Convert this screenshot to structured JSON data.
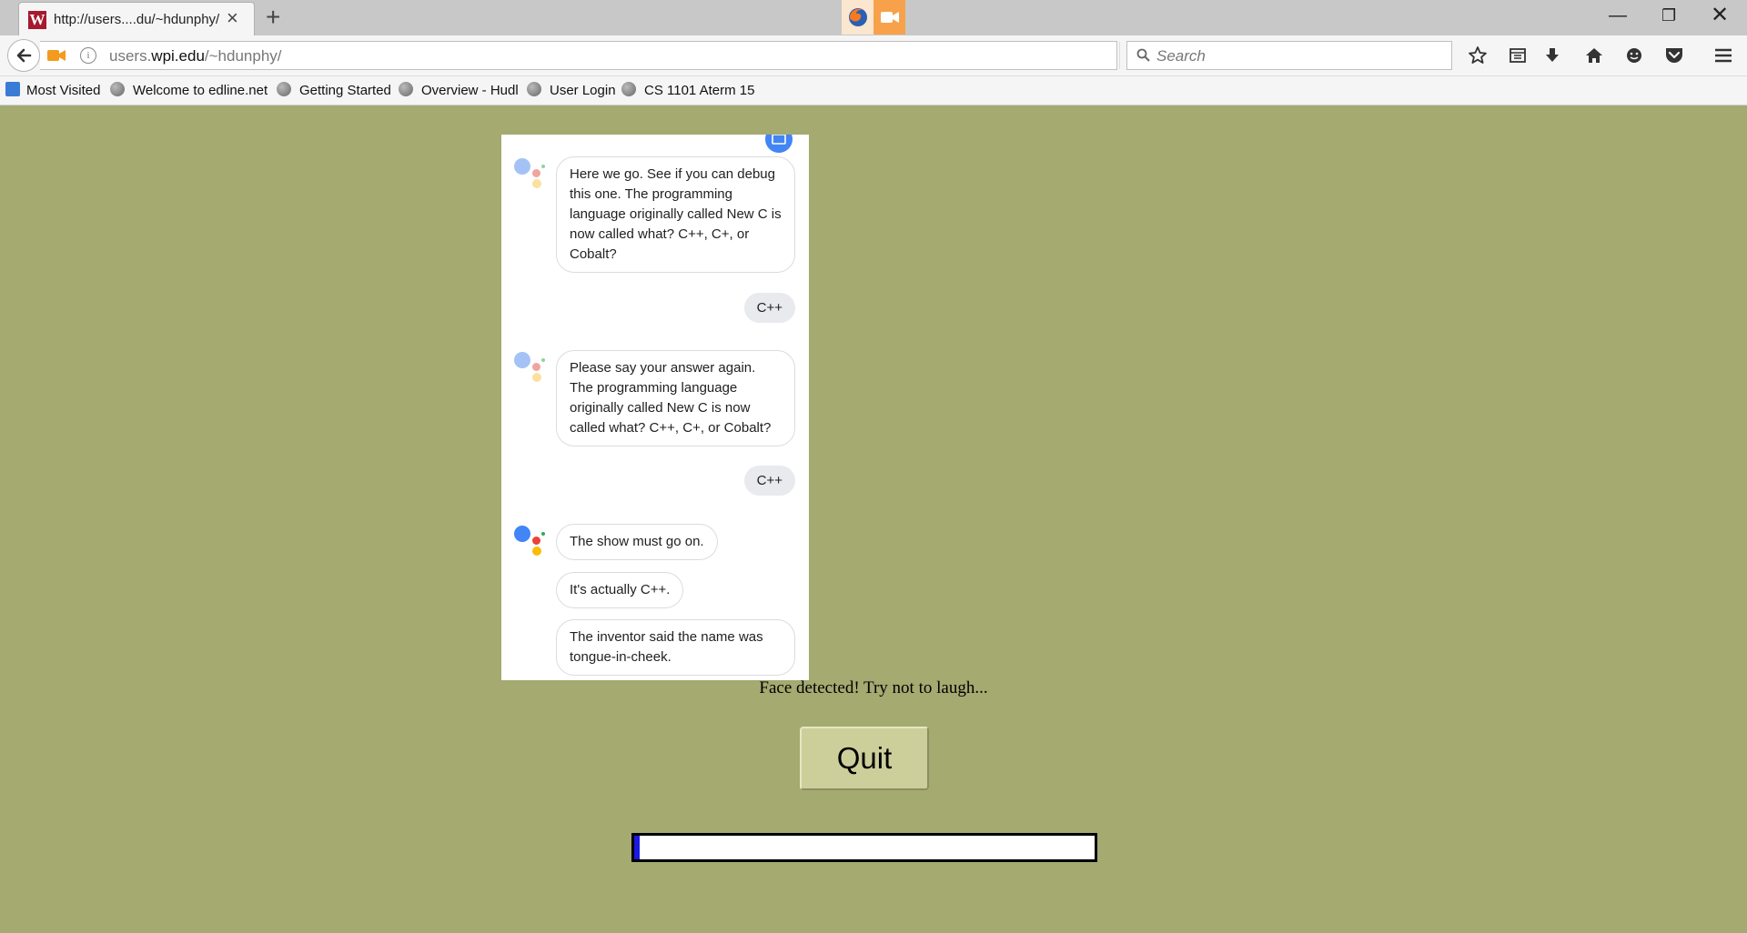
{
  "browser": {
    "tab_title": "http://users....du/~hdunphy/",
    "tab_favicon_letter": "W",
    "url_prefix": "users.",
    "url_host": "wpi.edu",
    "url_path": "/~hdunphy/",
    "search_placeholder": "Search",
    "bookmarks": [
      {
        "label": "Most Visited"
      },
      {
        "label": "Welcome to edline.net"
      },
      {
        "label": "Getting Started"
      },
      {
        "label": "Overview - Hudl"
      },
      {
        "label": "User Login"
      },
      {
        "label": "CS 1101 Aterm 15"
      }
    ]
  },
  "chat": {
    "messages": [
      {
        "role": "assistant",
        "text": "Here we go. See if you can debug this one. The programming language originally called New C is now called what? C++, C+, or Cobalt?"
      },
      {
        "role": "user",
        "text": "C++"
      },
      {
        "role": "assistant",
        "text": "Please say your answer again. The programming language originally called New C is now called what? C++, C+, or Cobalt?"
      },
      {
        "role": "user",
        "text": "C++"
      },
      {
        "role": "assistant",
        "text": "The show must go on."
      },
      {
        "role": "assistant",
        "text": "It's actually C++."
      },
      {
        "role": "assistant",
        "text": "The inventor said the name was tongue-in-cheek."
      }
    ]
  },
  "status_text": "Face detected! Try not to laugh...",
  "quit_label": "Quit",
  "progress_fraction": 0.012,
  "colors": {
    "page_background": "#a4aa70",
    "quit_button": "#cdcf9a",
    "progress_fill": "#1a1ae0",
    "tab_favicon": "#a6192e",
    "sharing_indicator": "#f7a24b"
  }
}
